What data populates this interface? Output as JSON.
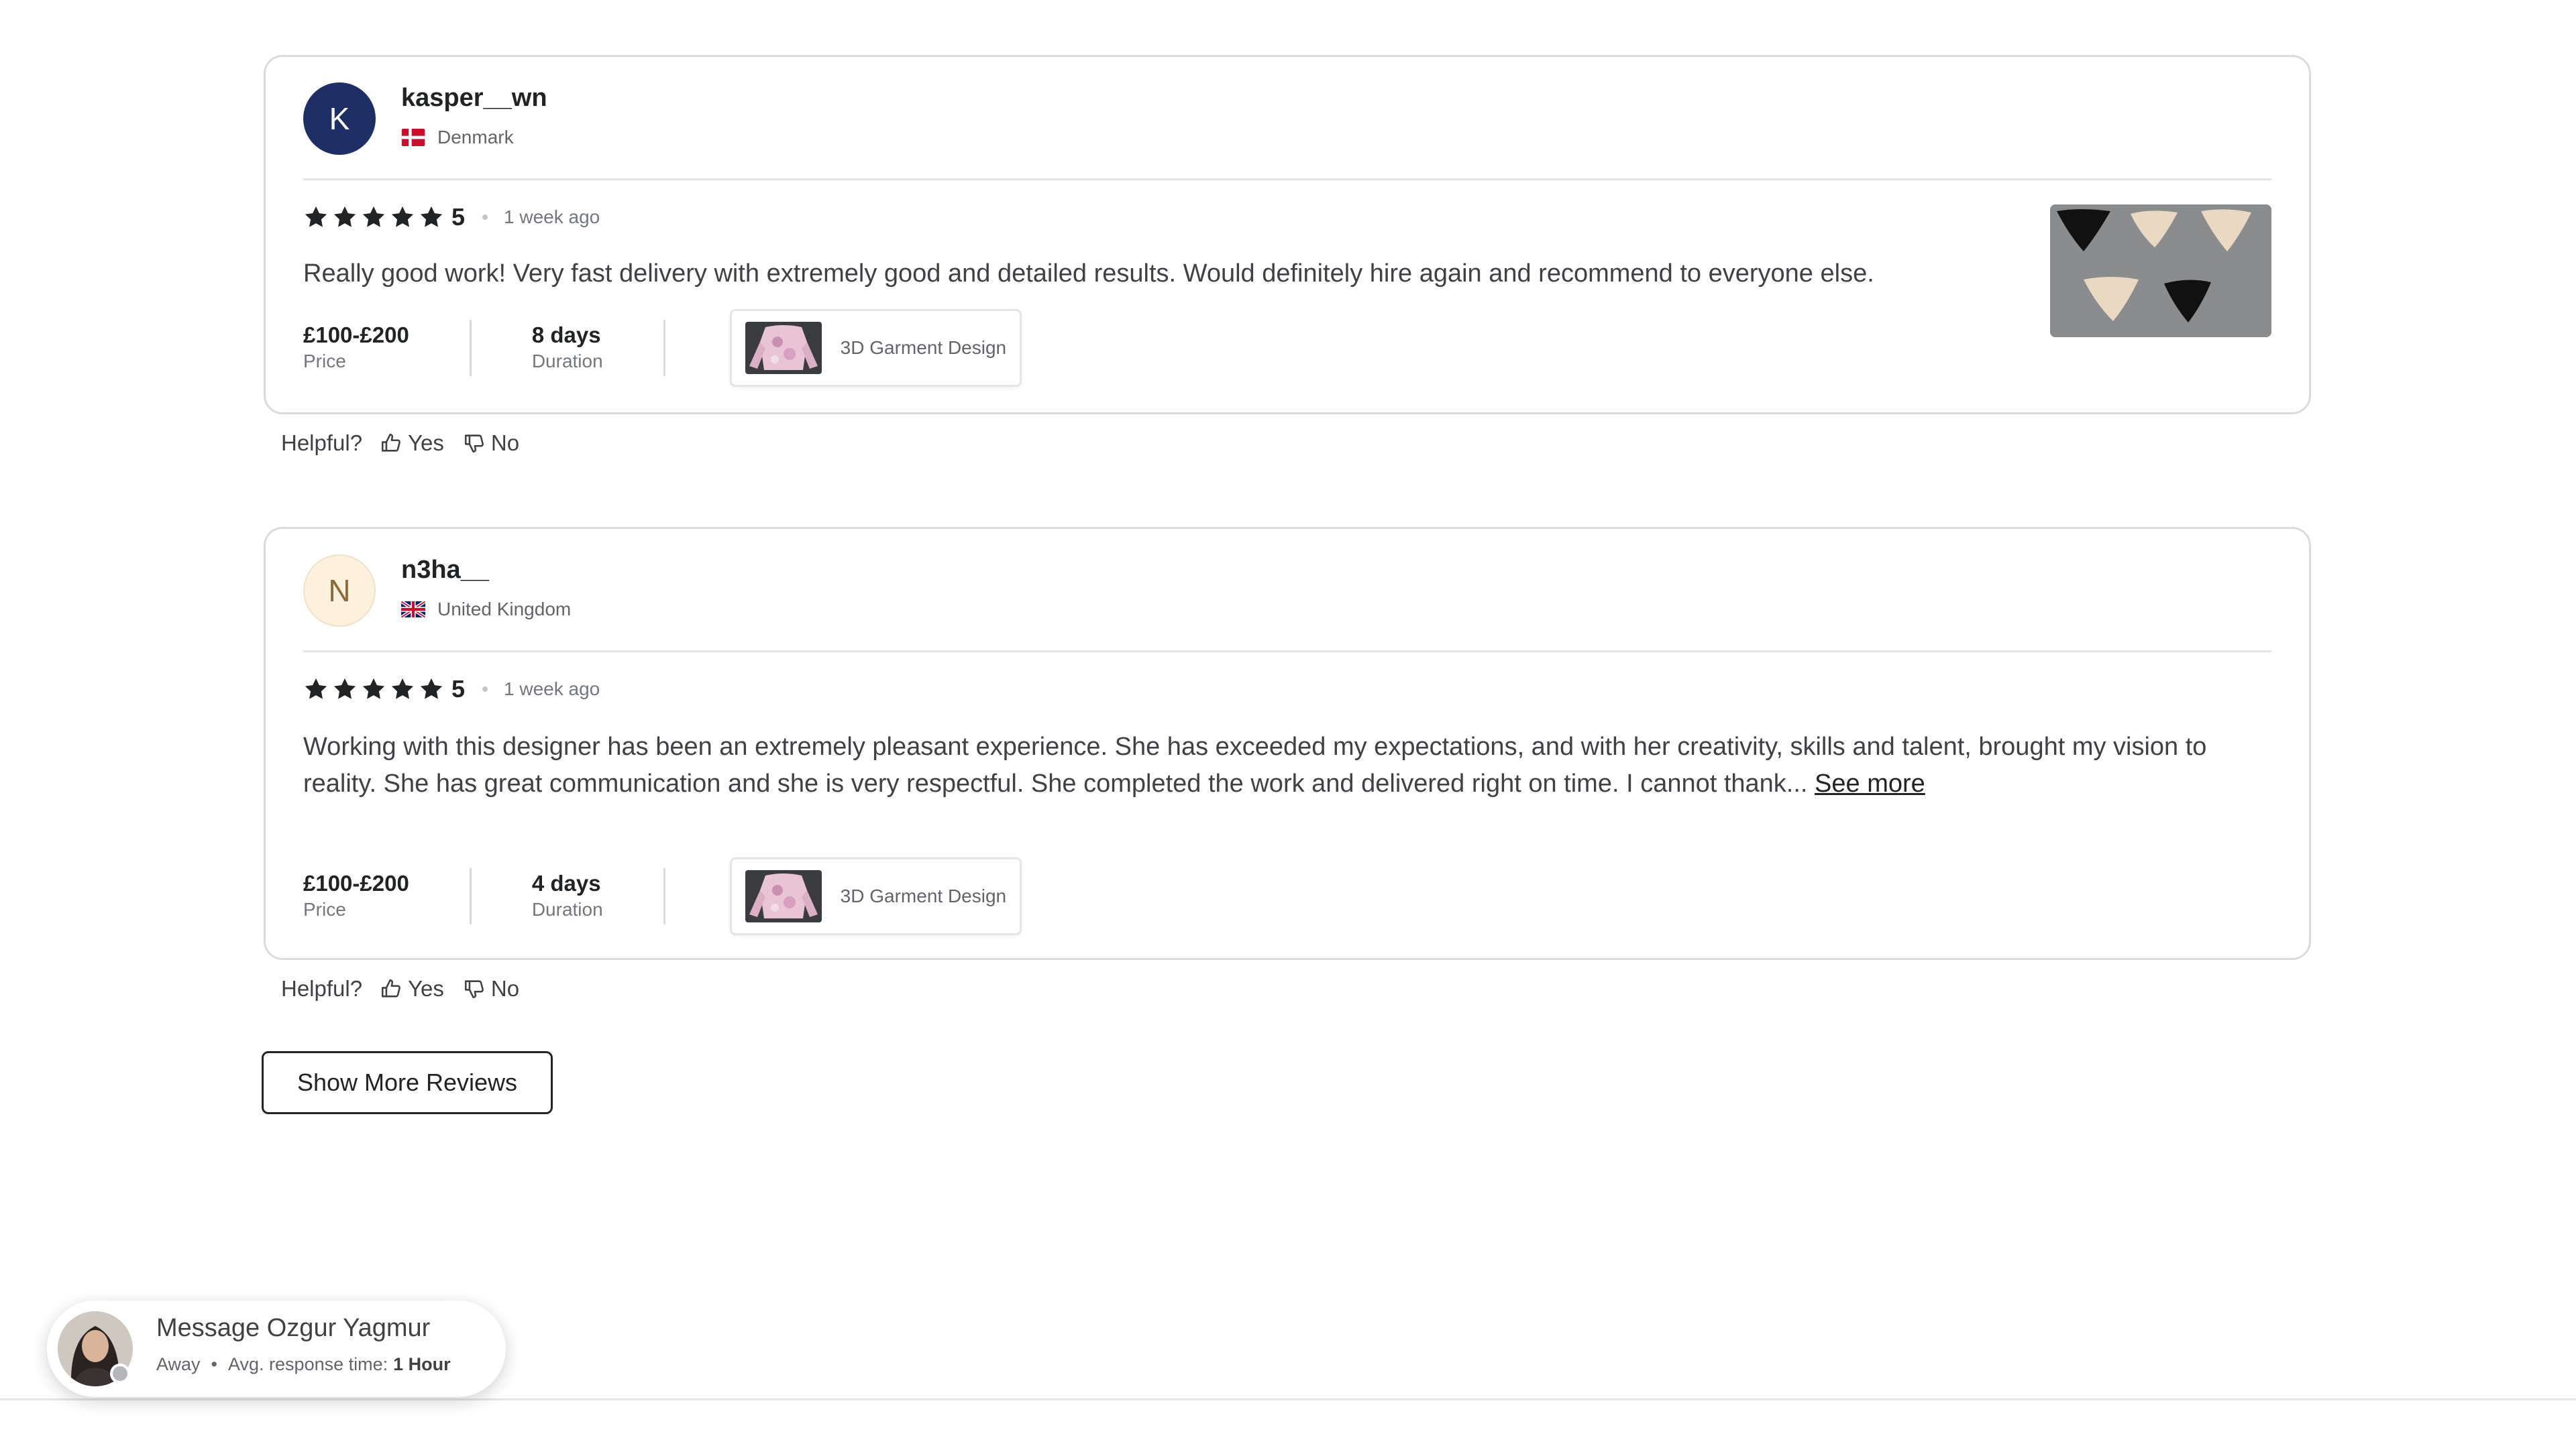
{
  "reviews": [
    {
      "avatar_letter": "K",
      "username": "kasper__wn",
      "country": "Denmark",
      "rating": "5",
      "time": "1 week ago",
      "text": "Really good work! Very fast delivery with extremely good and detailed results. Would definitely hire again and recommend to everyone else.",
      "price_value": "£100-£200",
      "price_label": "Price",
      "duration_value": "8 days",
      "duration_label": "Duration",
      "gig_label": "3D Garment Design"
    },
    {
      "avatar_letter": "N",
      "username": "n3ha__",
      "country": "United Kingdom",
      "rating": "5",
      "time": "1 week ago",
      "text": "Working with this designer has been an extremely pleasant experience. She has exceeded my expectations, and with her creativity, skills and talent, brought my vision to reality. She has great communication and she is very respectful. She completed the work and delivered right on time. I cannot thank...",
      "see_more": "See more",
      "price_value": "£100-£200",
      "price_label": "Price",
      "duration_value": "4 days",
      "duration_label": "Duration",
      "gig_label": "3D Garment Design"
    }
  ],
  "helpful": {
    "question": "Helpful?",
    "yes": "Yes",
    "no": "No"
  },
  "show_more_reviews": "Show More Reviews",
  "message_seller": {
    "title": "Message Ozgur Yagmur",
    "status": "Away",
    "response_label": "Avg. response time:",
    "response_value": "1 Hour"
  }
}
